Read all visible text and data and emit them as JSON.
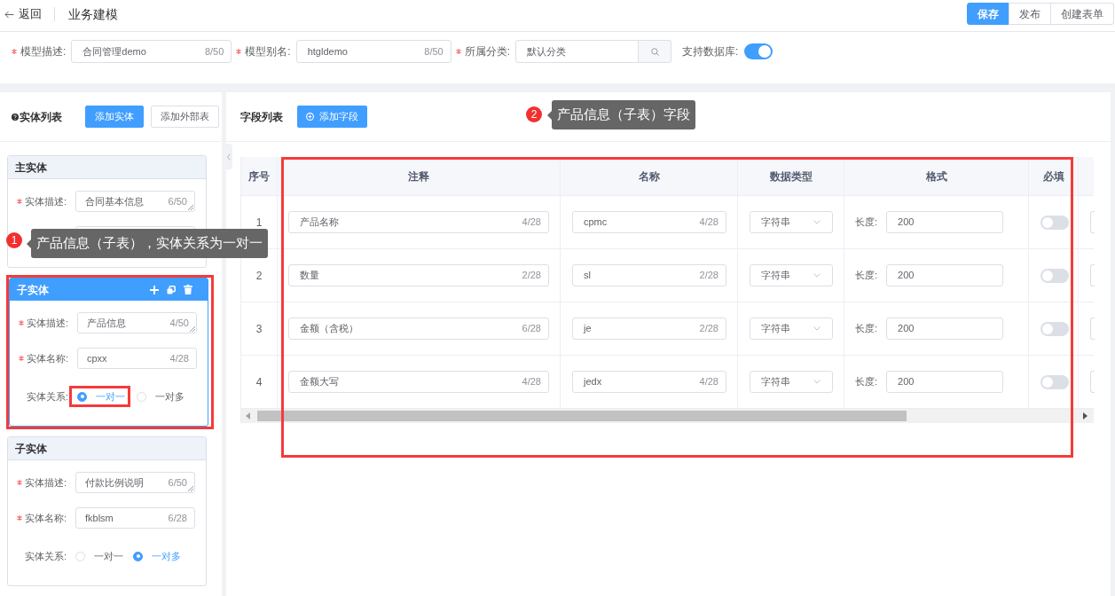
{
  "header": {
    "back": "返回",
    "title": "业务建模",
    "actions": [
      {
        "label": "保存",
        "kind": "primary"
      },
      {
        "label": "发布",
        "kind": "default"
      },
      {
        "label": "创建表单",
        "kind": "default"
      }
    ]
  },
  "model_form": {
    "fields": [
      {
        "label": "模型描述:",
        "required": true,
        "kind": "text",
        "value": "合同管理demo",
        "count": "8/50"
      },
      {
        "label": "模型别名:",
        "required": true,
        "kind": "text",
        "value": "htgldemo",
        "count": "8/50"
      },
      {
        "label": "所属分类:",
        "required": true,
        "kind": "search",
        "value": "默认分类"
      }
    ],
    "database_switch": {
      "label": "支持数据库:",
      "on": true
    }
  },
  "entities": {
    "title": "实体列表",
    "buttons": [
      {
        "label": "添加实体",
        "kind": "primary"
      },
      {
        "label": "添加外部表",
        "kind": "default"
      }
    ],
    "cards": [
      {
        "title": "主实体",
        "selected": false,
        "fields": [
          {
            "kind": "textarea",
            "label": "实体描述:",
            "required": true,
            "value": "合同基本信息",
            "count": "6/50"
          },
          {
            "kind": "input"
          }
        ]
      },
      {
        "title": "子实体",
        "selected": true,
        "highlighted": true,
        "fields": [
          {
            "kind": "textarea",
            "label": "实体描述:",
            "required": true,
            "value": "产品信息",
            "count": "4/50"
          },
          {
            "kind": "input",
            "label": "实体名称:",
            "required": true,
            "value": "cpxx",
            "count": "4/28"
          }
        ],
        "relation": {
          "label": "实体关系:",
          "options": [
            {
              "label": "一对一",
              "selected": true,
              "highlighted": true
            },
            {
              "label": "一对多",
              "selected": false
            }
          ]
        }
      },
      {
        "title": "子实体",
        "selected": false,
        "fields": [
          {
            "kind": "textarea",
            "label": "实体描述:",
            "required": true,
            "value": "付款比例说明",
            "count": "6/50"
          },
          {
            "kind": "input",
            "label": "实体名称:",
            "required": true,
            "value": "fkblsm",
            "count": "6/28"
          }
        ],
        "relation": {
          "label": "实体关系:",
          "options": [
            {
              "label": "一对一",
              "selected": false
            },
            {
              "label": "一对多",
              "selected": true
            }
          ]
        }
      }
    ]
  },
  "fields_panel": {
    "title": "字段列表",
    "add_button": "添加字段",
    "table": {
      "highlighted": true,
      "columns": [
        "序号",
        "注释",
        "名称",
        "数据类型",
        "格式",
        "必填"
      ],
      "rows": [
        {
          "index": "1",
          "comment": "产品名称",
          "comment_count": "4/28",
          "name": "cpmc",
          "name_count": "4/28",
          "type": "字符串",
          "format_label": "长度:",
          "length": "200",
          "required": false
        },
        {
          "index": "2",
          "comment": "数量",
          "comment_count": "2/28",
          "name": "sl",
          "name_count": "2/28",
          "type": "字符串",
          "format_label": "长度:",
          "length": "200",
          "required": false
        },
        {
          "index": "3",
          "comment": "金额（含税）",
          "comment_count": "6/28",
          "name": "je",
          "name_count": "2/28",
          "type": "字符串",
          "format_label": "长度:",
          "length": "200",
          "required": false
        },
        {
          "index": "4",
          "comment": "金额大写",
          "comment_count": "4/28",
          "name": "jedx",
          "name_count": "4/28",
          "type": "字符串",
          "format_label": "长度:",
          "length": "200",
          "required": false
        }
      ]
    }
  },
  "annotations": [
    {
      "number": "1",
      "text": "产品信息（子表），实体关系为一对一"
    },
    {
      "number": "2",
      "text": "产品信息（子表）字段"
    }
  ]
}
